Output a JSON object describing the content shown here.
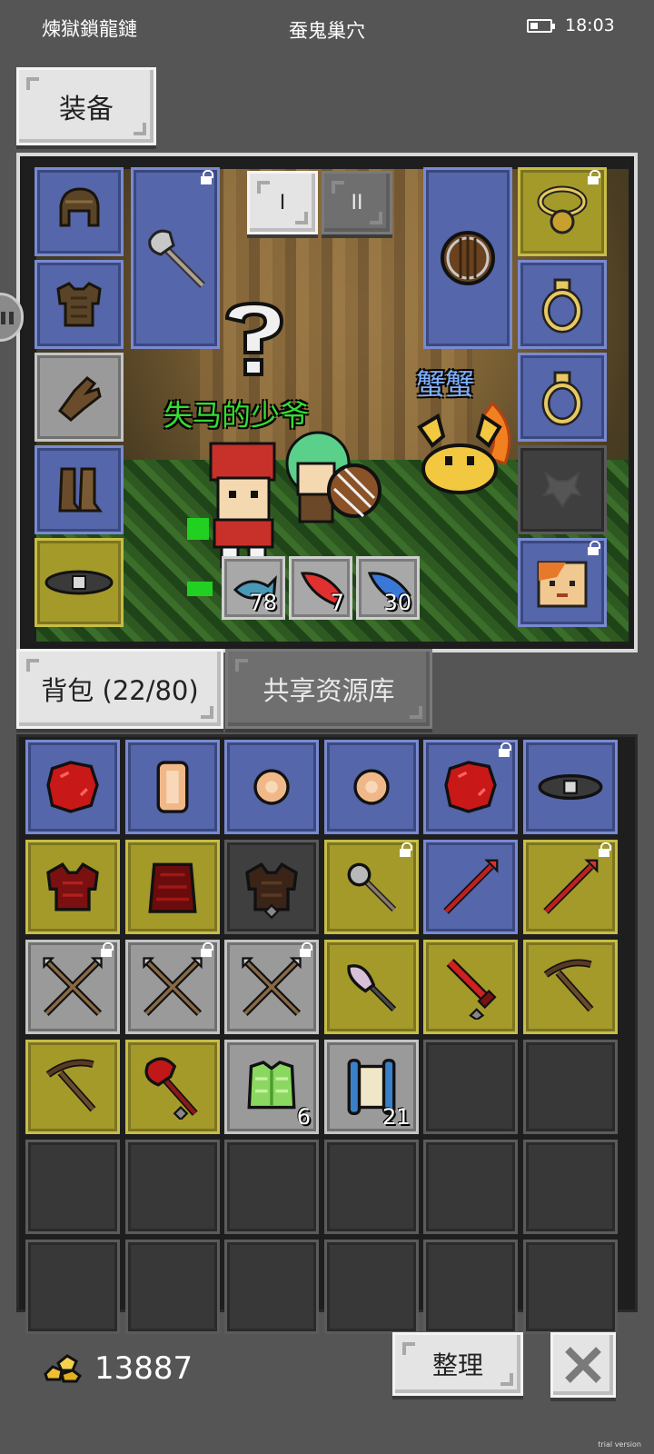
{
  "status_bar": {
    "left_text": "煉獄鎖龍鏈",
    "center_text": "蚕鬼巢穴",
    "time": "18:03"
  },
  "equip_tab": {
    "label": "装备"
  },
  "weapon_set_buttons": [
    "I",
    "II"
  ],
  "characters": {
    "player_name": "失马的少爷",
    "player_name_color": "#33dd33",
    "pet_name": "蟹蟹",
    "pet_name_color": "#7fb0ff"
  },
  "equip_slots": {
    "left": [
      {
        "icon": "leather-helmet-icon",
        "color": "blue"
      },
      {
        "icon": "leather-armor-icon",
        "color": "blue"
      },
      {
        "icon": "leather-gloves-icon",
        "color": "gray"
      },
      {
        "icon": "leather-boots-icon",
        "color": "blue"
      },
      {
        "icon": "belt-icon",
        "color": "olive"
      }
    ],
    "main_hand": {
      "icon": "axe-icon",
      "locked": true
    },
    "off_hand": {
      "icon": "round-shield-icon"
    },
    "right": [
      {
        "icon": "amulet-icon",
        "color": "olive",
        "locked": true
      },
      {
        "icon": "ring-icon",
        "color": "blue"
      },
      {
        "icon": "ring-icon",
        "color": "blue"
      },
      {
        "icon": "empty-slot-icon",
        "color": "dark"
      },
      {
        "icon": "pet-portrait-icon",
        "color": "blue",
        "locked": true
      }
    ]
  },
  "consumables": [
    {
      "icon": "blue-fish-icon",
      "count": "78"
    },
    {
      "icon": "red-feather-icon",
      "count": "7"
    },
    {
      "icon": "blue-feather-icon",
      "count": "30"
    }
  ],
  "bag_tab": {
    "label": "背包 (22/80)"
  },
  "shared_tab": {
    "label": "共享资源库"
  },
  "bag_items": [
    {
      "icon": "red-crystal-icon",
      "color": "blue",
      "locked": false,
      "count": ""
    },
    {
      "icon": "copper-coin-scroll-icon",
      "color": "blue",
      "locked": false,
      "count": ""
    },
    {
      "icon": "copper-coin-icon",
      "color": "blue",
      "locked": false,
      "count": ""
    },
    {
      "icon": "copper-coin-icon",
      "color": "blue",
      "locked": false,
      "count": ""
    },
    {
      "icon": "red-crystal-icon",
      "color": "blue",
      "locked": true,
      "count": ""
    },
    {
      "icon": "belt-icon",
      "color": "blue",
      "locked": false,
      "count": ""
    },
    {
      "icon": "dark-red-armor-icon",
      "color": "olive",
      "locked": false,
      "count": ""
    },
    {
      "icon": "dark-red-robe-icon",
      "color": "olive",
      "locked": false,
      "count": ""
    },
    {
      "icon": "brown-armor-icon",
      "color": "darkslot",
      "locked": false,
      "count": ""
    },
    {
      "icon": "mace-icon",
      "color": "olive",
      "locked": true,
      "count": ""
    },
    {
      "icon": "red-spear-icon",
      "color": "blue",
      "locked": false,
      "count": ""
    },
    {
      "icon": "red-spear-icon",
      "color": "olive",
      "locked": true,
      "count": ""
    },
    {
      "icon": "crossed-spears-icon",
      "color": "gray",
      "locked": true,
      "count": ""
    },
    {
      "icon": "crossed-spears-icon",
      "color": "gray",
      "locked": true,
      "count": ""
    },
    {
      "icon": "crossed-spears-icon",
      "color": "gray",
      "locked": true,
      "count": ""
    },
    {
      "icon": "feather-wand-icon",
      "color": "olive",
      "locked": false,
      "count": ""
    },
    {
      "icon": "red-sword-icon",
      "color": "olive",
      "locked": false,
      "count": ""
    },
    {
      "icon": "crossbow-icon",
      "color": "olive",
      "locked": false,
      "count": ""
    },
    {
      "icon": "crossbow-icon",
      "color": "olive",
      "locked": false,
      "count": ""
    },
    {
      "icon": "red-battle-axe-icon",
      "color": "olive",
      "locked": false,
      "count": ""
    },
    {
      "icon": "green-vest-icon",
      "color": "gray",
      "locked": false,
      "count": "6"
    },
    {
      "icon": "scroll-icon",
      "color": "gray",
      "locked": false,
      "count": "21"
    }
  ],
  "bag_capacity_visible_slots": 36,
  "gold": {
    "icon": "gold-nugget-icon",
    "amount": "13887"
  },
  "sort_button": {
    "label": "整理"
  },
  "close_button": {
    "icon": "close-icon"
  },
  "watermark": "trial version"
}
